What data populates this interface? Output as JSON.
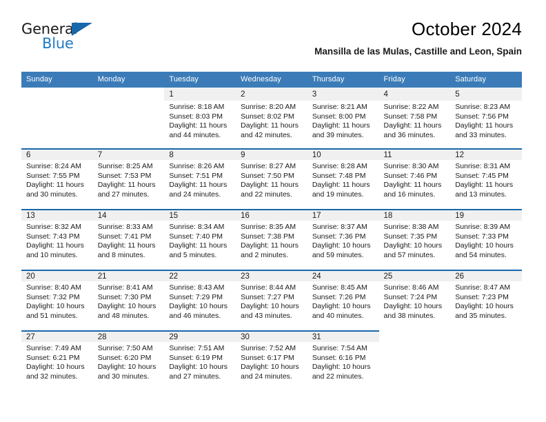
{
  "brand": {
    "name_part1": "General",
    "name_part2": "Blue",
    "triangle_color": "#1767ab",
    "blue_color": "#1f7ac4"
  },
  "header": {
    "title": "October 2024",
    "subtitle": "Mansilla de las Mulas, Castille and Leon, Spain",
    "header_bg": "#3b7cb8",
    "row_divider": "#1767ab",
    "date_strip_bg": "#f0f0f0"
  },
  "weekday_headers": [
    "Sunday",
    "Monday",
    "Tuesday",
    "Wednesday",
    "Thursday",
    "Friday",
    "Saturday"
  ],
  "weeks": [
    [
      {
        "date": "",
        "lines": []
      },
      {
        "date": "",
        "lines": []
      },
      {
        "date": "1",
        "lines": [
          "Sunrise: 8:18 AM",
          "Sunset: 8:03 PM",
          "Daylight: 11 hours",
          "and 44 minutes."
        ]
      },
      {
        "date": "2",
        "lines": [
          "Sunrise: 8:20 AM",
          "Sunset: 8:02 PM",
          "Daylight: 11 hours",
          "and 42 minutes."
        ]
      },
      {
        "date": "3",
        "lines": [
          "Sunrise: 8:21 AM",
          "Sunset: 8:00 PM",
          "Daylight: 11 hours",
          "and 39 minutes."
        ]
      },
      {
        "date": "4",
        "lines": [
          "Sunrise: 8:22 AM",
          "Sunset: 7:58 PM",
          "Daylight: 11 hours",
          "and 36 minutes."
        ]
      },
      {
        "date": "5",
        "lines": [
          "Sunrise: 8:23 AM",
          "Sunset: 7:56 PM",
          "Daylight: 11 hours",
          "and 33 minutes."
        ]
      }
    ],
    [
      {
        "date": "6",
        "lines": [
          "Sunrise: 8:24 AM",
          "Sunset: 7:55 PM",
          "Daylight: 11 hours",
          "and 30 minutes."
        ]
      },
      {
        "date": "7",
        "lines": [
          "Sunrise: 8:25 AM",
          "Sunset: 7:53 PM",
          "Daylight: 11 hours",
          "and 27 minutes."
        ]
      },
      {
        "date": "8",
        "lines": [
          "Sunrise: 8:26 AM",
          "Sunset: 7:51 PM",
          "Daylight: 11 hours",
          "and 24 minutes."
        ]
      },
      {
        "date": "9",
        "lines": [
          "Sunrise: 8:27 AM",
          "Sunset: 7:50 PM",
          "Daylight: 11 hours",
          "and 22 minutes."
        ]
      },
      {
        "date": "10",
        "lines": [
          "Sunrise: 8:28 AM",
          "Sunset: 7:48 PM",
          "Daylight: 11 hours",
          "and 19 minutes."
        ]
      },
      {
        "date": "11",
        "lines": [
          "Sunrise: 8:30 AM",
          "Sunset: 7:46 PM",
          "Daylight: 11 hours",
          "and 16 minutes."
        ]
      },
      {
        "date": "12",
        "lines": [
          "Sunrise: 8:31 AM",
          "Sunset: 7:45 PM",
          "Daylight: 11 hours",
          "and 13 minutes."
        ]
      }
    ],
    [
      {
        "date": "13",
        "lines": [
          "Sunrise: 8:32 AM",
          "Sunset: 7:43 PM",
          "Daylight: 11 hours",
          "and 10 minutes."
        ]
      },
      {
        "date": "14",
        "lines": [
          "Sunrise: 8:33 AM",
          "Sunset: 7:41 PM",
          "Daylight: 11 hours",
          "and 8 minutes."
        ]
      },
      {
        "date": "15",
        "lines": [
          "Sunrise: 8:34 AM",
          "Sunset: 7:40 PM",
          "Daylight: 11 hours",
          "and 5 minutes."
        ]
      },
      {
        "date": "16",
        "lines": [
          "Sunrise: 8:35 AM",
          "Sunset: 7:38 PM",
          "Daylight: 11 hours",
          "and 2 minutes."
        ]
      },
      {
        "date": "17",
        "lines": [
          "Sunrise: 8:37 AM",
          "Sunset: 7:36 PM",
          "Daylight: 10 hours",
          "and 59 minutes."
        ]
      },
      {
        "date": "18",
        "lines": [
          "Sunrise: 8:38 AM",
          "Sunset: 7:35 PM",
          "Daylight: 10 hours",
          "and 57 minutes."
        ]
      },
      {
        "date": "19",
        "lines": [
          "Sunrise: 8:39 AM",
          "Sunset: 7:33 PM",
          "Daylight: 10 hours",
          "and 54 minutes."
        ]
      }
    ],
    [
      {
        "date": "20",
        "lines": [
          "Sunrise: 8:40 AM",
          "Sunset: 7:32 PM",
          "Daylight: 10 hours",
          "and 51 minutes."
        ]
      },
      {
        "date": "21",
        "lines": [
          "Sunrise: 8:41 AM",
          "Sunset: 7:30 PM",
          "Daylight: 10 hours",
          "and 48 minutes."
        ]
      },
      {
        "date": "22",
        "lines": [
          "Sunrise: 8:43 AM",
          "Sunset: 7:29 PM",
          "Daylight: 10 hours",
          "and 46 minutes."
        ]
      },
      {
        "date": "23",
        "lines": [
          "Sunrise: 8:44 AM",
          "Sunset: 7:27 PM",
          "Daylight: 10 hours",
          "and 43 minutes."
        ]
      },
      {
        "date": "24",
        "lines": [
          "Sunrise: 8:45 AM",
          "Sunset: 7:26 PM",
          "Daylight: 10 hours",
          "and 40 minutes."
        ]
      },
      {
        "date": "25",
        "lines": [
          "Sunrise: 8:46 AM",
          "Sunset: 7:24 PM",
          "Daylight: 10 hours",
          "and 38 minutes."
        ]
      },
      {
        "date": "26",
        "lines": [
          "Sunrise: 8:47 AM",
          "Sunset: 7:23 PM",
          "Daylight: 10 hours",
          "and 35 minutes."
        ]
      }
    ],
    [
      {
        "date": "27",
        "lines": [
          "Sunrise: 7:49 AM",
          "Sunset: 6:21 PM",
          "Daylight: 10 hours",
          "and 32 minutes."
        ]
      },
      {
        "date": "28",
        "lines": [
          "Sunrise: 7:50 AM",
          "Sunset: 6:20 PM",
          "Daylight: 10 hours",
          "and 30 minutes."
        ]
      },
      {
        "date": "29",
        "lines": [
          "Sunrise: 7:51 AM",
          "Sunset: 6:19 PM",
          "Daylight: 10 hours",
          "and 27 minutes."
        ]
      },
      {
        "date": "30",
        "lines": [
          "Sunrise: 7:52 AM",
          "Sunset: 6:17 PM",
          "Daylight: 10 hours",
          "and 24 minutes."
        ]
      },
      {
        "date": "31",
        "lines": [
          "Sunrise: 7:54 AM",
          "Sunset: 6:16 PM",
          "Daylight: 10 hours",
          "and 22 minutes."
        ]
      },
      {
        "date": "",
        "lines": []
      },
      {
        "date": "",
        "lines": []
      }
    ]
  ]
}
